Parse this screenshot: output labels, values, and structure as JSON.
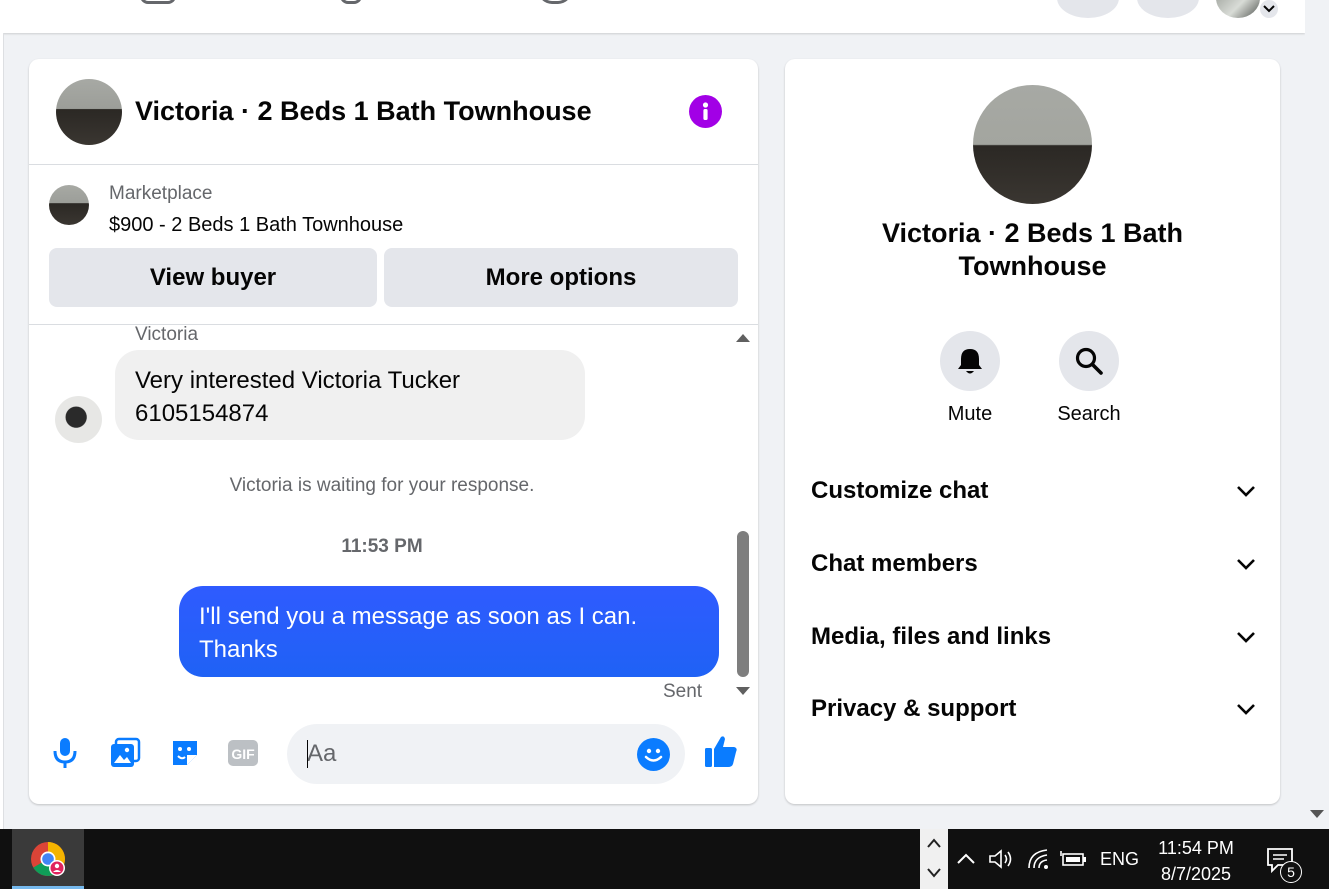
{
  "chat": {
    "title": "Victoria · 2 Beds 1 Bath Townhouse",
    "marketplace_label": "Marketplace",
    "listing": "$900 - 2 Beds 1 Bath Townhouse",
    "view_buyer_label": "View buyer",
    "more_options_label": "More options",
    "sender_name": "Victoria",
    "incoming_message": "Very interested Victoria Tucker 6105154874",
    "waiting_notice": "Victoria is waiting for your response.",
    "timestamp": "11:53 PM",
    "outgoing_message": "I'll send you a message as soon as I can. Thanks",
    "status": "Sent",
    "composer": {
      "placeholder": "Aa"
    }
  },
  "info_panel": {
    "name": "Victoria · 2 Beds 1 Bath Townhouse",
    "actions": [
      {
        "label": "Mute",
        "icon": "bell-icon"
      },
      {
        "label": "Search",
        "icon": "search-icon"
      }
    ],
    "sections": [
      {
        "label": "Customize chat"
      },
      {
        "label": "Chat members"
      },
      {
        "label": "Media, files and links"
      },
      {
        "label": "Privacy & support"
      }
    ]
  },
  "taskbar": {
    "language": "ENG",
    "time": "11:54 PM",
    "date": "8/7/2025",
    "notification_count": "5"
  },
  "colors": {
    "accent_blue": "#0a7cff",
    "outgoing_bubble": "#2f5bff",
    "info_purple": "#a200e6"
  }
}
